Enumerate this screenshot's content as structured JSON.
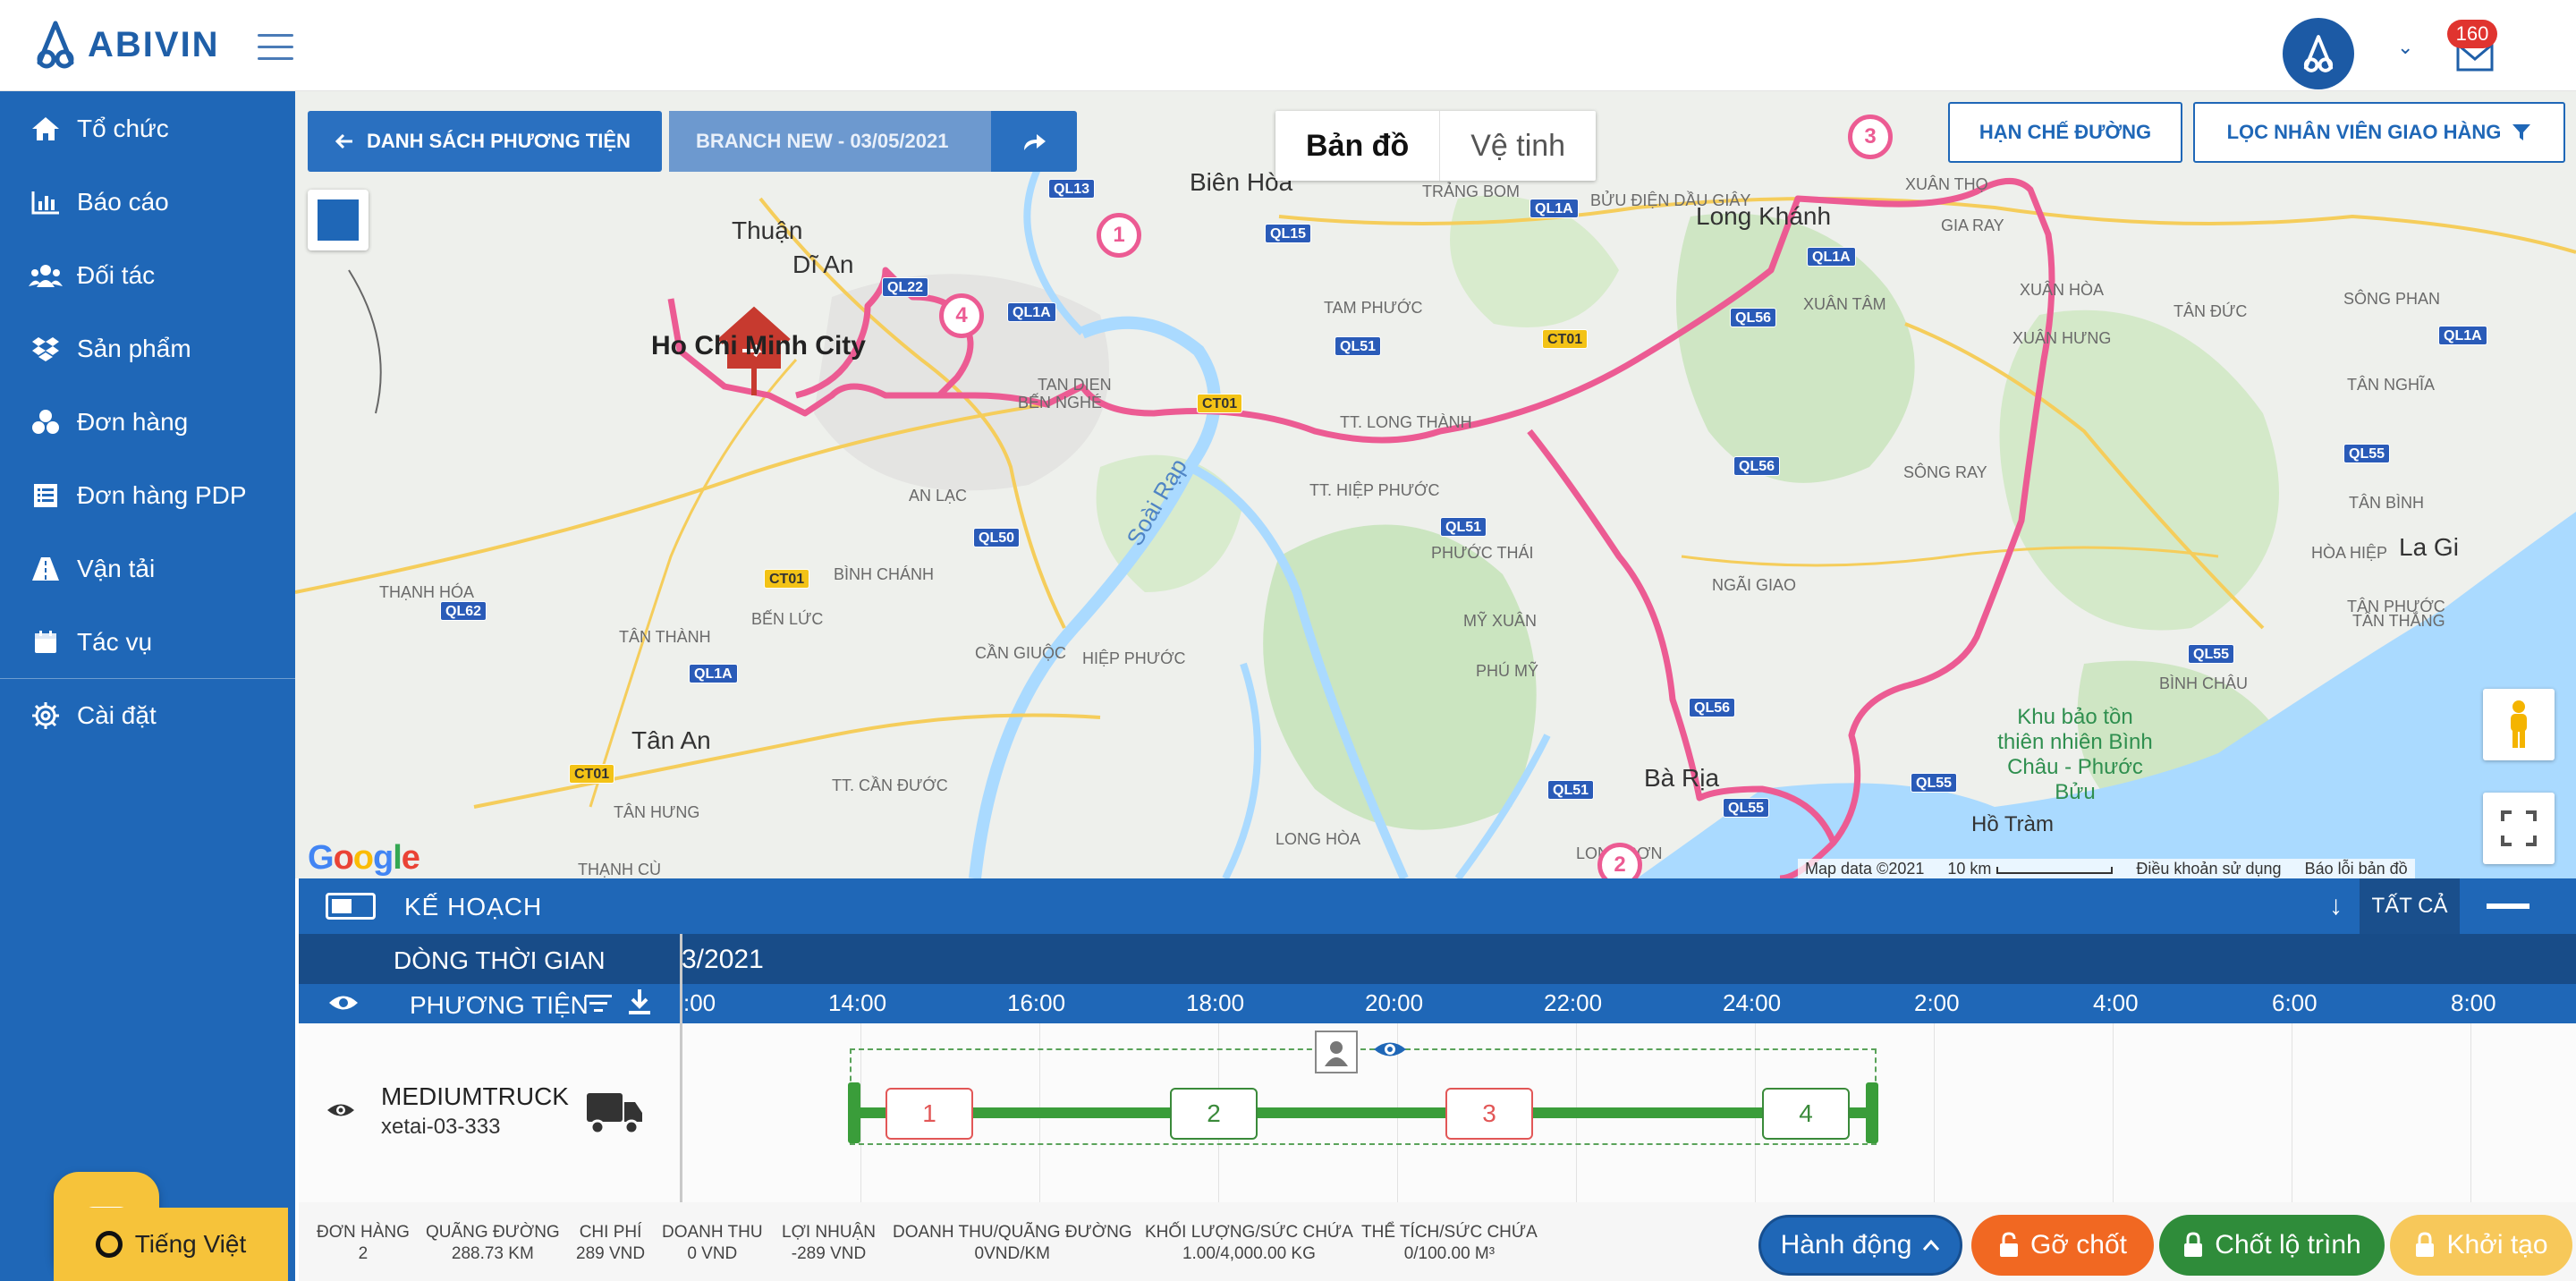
{
  "header": {
    "logo_text": "ABIVIN",
    "mail_badge": "160"
  },
  "sidebar": {
    "items": [
      {
        "label": "Tổ chức",
        "icon": "home-icon"
      },
      {
        "label": "Báo cáo",
        "icon": "bar-chart-icon"
      },
      {
        "label": "Đối tác",
        "icon": "users-icon"
      },
      {
        "label": "Sản phẩm",
        "icon": "dropbox-icon"
      },
      {
        "label": "Đơn hàng",
        "icon": "cubes-icon"
      },
      {
        "label": "Đơn hàng PDP",
        "icon": "list-icon"
      },
      {
        "label": "Vận tải",
        "icon": "road-icon"
      },
      {
        "label": "Tác vụ",
        "icon": "calendar-icon"
      },
      {
        "label": "Cài đặt",
        "icon": "gear-icon"
      }
    ],
    "language": "Tiếng Việt"
  },
  "map": {
    "vehicle_list_button": "DANH SÁCH PHƯƠNG TIỆN",
    "branch_button": "BRANCH NEW - 03/05/2021",
    "map_types": [
      "Bản đồ",
      "Vệ tinh"
    ],
    "restrict_button": "HẠN CHẾ ĐƯỜNG",
    "filter_button": "LỌC NHÂN VIÊN GIAO HÀNG",
    "google_logo": "Google",
    "attribution": {
      "map_data": "Map data ©2021",
      "scale": "10 km",
      "terms": "Điều khoản sử dụng",
      "report": "Báo lỗi bản đồ"
    },
    "stops": [
      "1",
      "2",
      "3",
      "4"
    ],
    "labels": {
      "hcm": "Ho Chi Minh City",
      "di_an": "Dĩ An",
      "thuan": "Thuận",
      "bien_hoa": "Biên Hòa",
      "long_khanh": "Long Khánh",
      "ba_ria": "Bà Rịa",
      "la_gi": "La Gi",
      "tan_an": "Tân An",
      "ho_tram": "Hồ Tràm",
      "park": "Khu bảo tồn thiên nhiên Bình Châu - Phước Bửu",
      "soai_rap": "Soài Rạp",
      "minor": [
        "TRẢNG BOM",
        "BỬU ĐIỆN DẦU GIÂY",
        "XUÂN THỌ",
        "GIA RAY",
        "XUÂN TÂM",
        "XUÂN HÒA",
        "TÂN ĐỨC",
        "SÔNG PHAN",
        "XUÂN HƯNG",
        "TÂN NGHĨA",
        "TAM PHƯỚC",
        "TT. LONG THÀNH",
        "TT. HIỆP PHƯỚC",
        "PHƯỚC THÁI",
        "SÔNG RAY",
        "NGÃI GIAO",
        "MỸ XUÂN",
        "PHÚ MỸ",
        "AN LẠC",
        "BÌNH CHÁNH",
        "BẾN LỨC",
        "TÂN THÀNH",
        "THẠNH HÓA",
        "CẦN GIUỘC",
        "HIỆP PHƯỚC",
        "TT. CẦN ĐƯỚC",
        "TÂN HƯNG",
        "THẠNH CÙ",
        "LONG HÒA",
        "LONG SƠN",
        "HÒA HIỆP",
        "TÂN BÌNH",
        "TÂN THẮNG",
        "TÂN PHƯỚC",
        "BÌNH CHÂU",
        "BẾN NGHÉ",
        "TAN DIEN"
      ],
      "roads": [
        "QL1A",
        "QL13",
        "QL15",
        "QL22",
        "QL1A",
        "QL51",
        "CT01",
        "CT01",
        "QL56",
        "QL55",
        "QL1A",
        "QL56",
        "QL51",
        "QL50",
        "CT01",
        "QL62",
        "QL1A",
        "CT01",
        "QL56",
        "QL51",
        "QL55",
        "QL55",
        "QL55",
        "QL1A"
      ]
    }
  },
  "plan": {
    "title": "KẾ HOẠCH",
    "all_label": "TẤT CẢ",
    "timeline_label": "DÒNG THỜI GIAN",
    "timeline_date": "3/2021",
    "vehicle_header": "PHƯƠNG TIỆN",
    "ticks": [
      ":00",
      "14:00",
      "16:00",
      "18:00",
      "20:00",
      "22:00",
      "24:00",
      "2:00",
      "4:00",
      "6:00",
      "8:00"
    ],
    "vehicle": {
      "type": "MEDIUMTRUCK",
      "plate": "xetai-03-333",
      "stops": [
        {
          "label": "1",
          "status": "red"
        },
        {
          "label": "2",
          "status": "green"
        },
        {
          "label": "3",
          "status": "red"
        },
        {
          "label": "4",
          "status": "green"
        }
      ]
    }
  },
  "summary": {
    "stats": [
      {
        "label": "ĐƠN HÀNG",
        "value": "2"
      },
      {
        "label": "QUÃNG ĐƯỜNG",
        "value": "288.73 KM"
      },
      {
        "label": "CHI PHÍ",
        "value": "289 VND"
      },
      {
        "label": "DOANH THU",
        "value": "0 VND"
      },
      {
        "label": "LỢI NHUẬN",
        "value": "-289 VND"
      },
      {
        "label": "DOANH THU/QUÃNG ĐƯỜNG",
        "value": "0VND/KM"
      },
      {
        "label": "KHỐI LƯỢNG/SỨC CHỨA",
        "value": "1.00/4,000.00 KG"
      },
      {
        "label": "THỂ TÍCH/SỨC CHỨA",
        "value": "0/100.00 M³"
      }
    ],
    "actions": {
      "action": "Hành động",
      "unlock": "Gỡ chốt",
      "lock_route": "Chốt lộ trình",
      "init": "Khởi tạo"
    }
  },
  "colors": {
    "primary": "#1f67b7",
    "route": "#ec5b93",
    "accent_yellow": "#f6c33a",
    "orange": "#f16822",
    "green": "#2f8c3a"
  }
}
